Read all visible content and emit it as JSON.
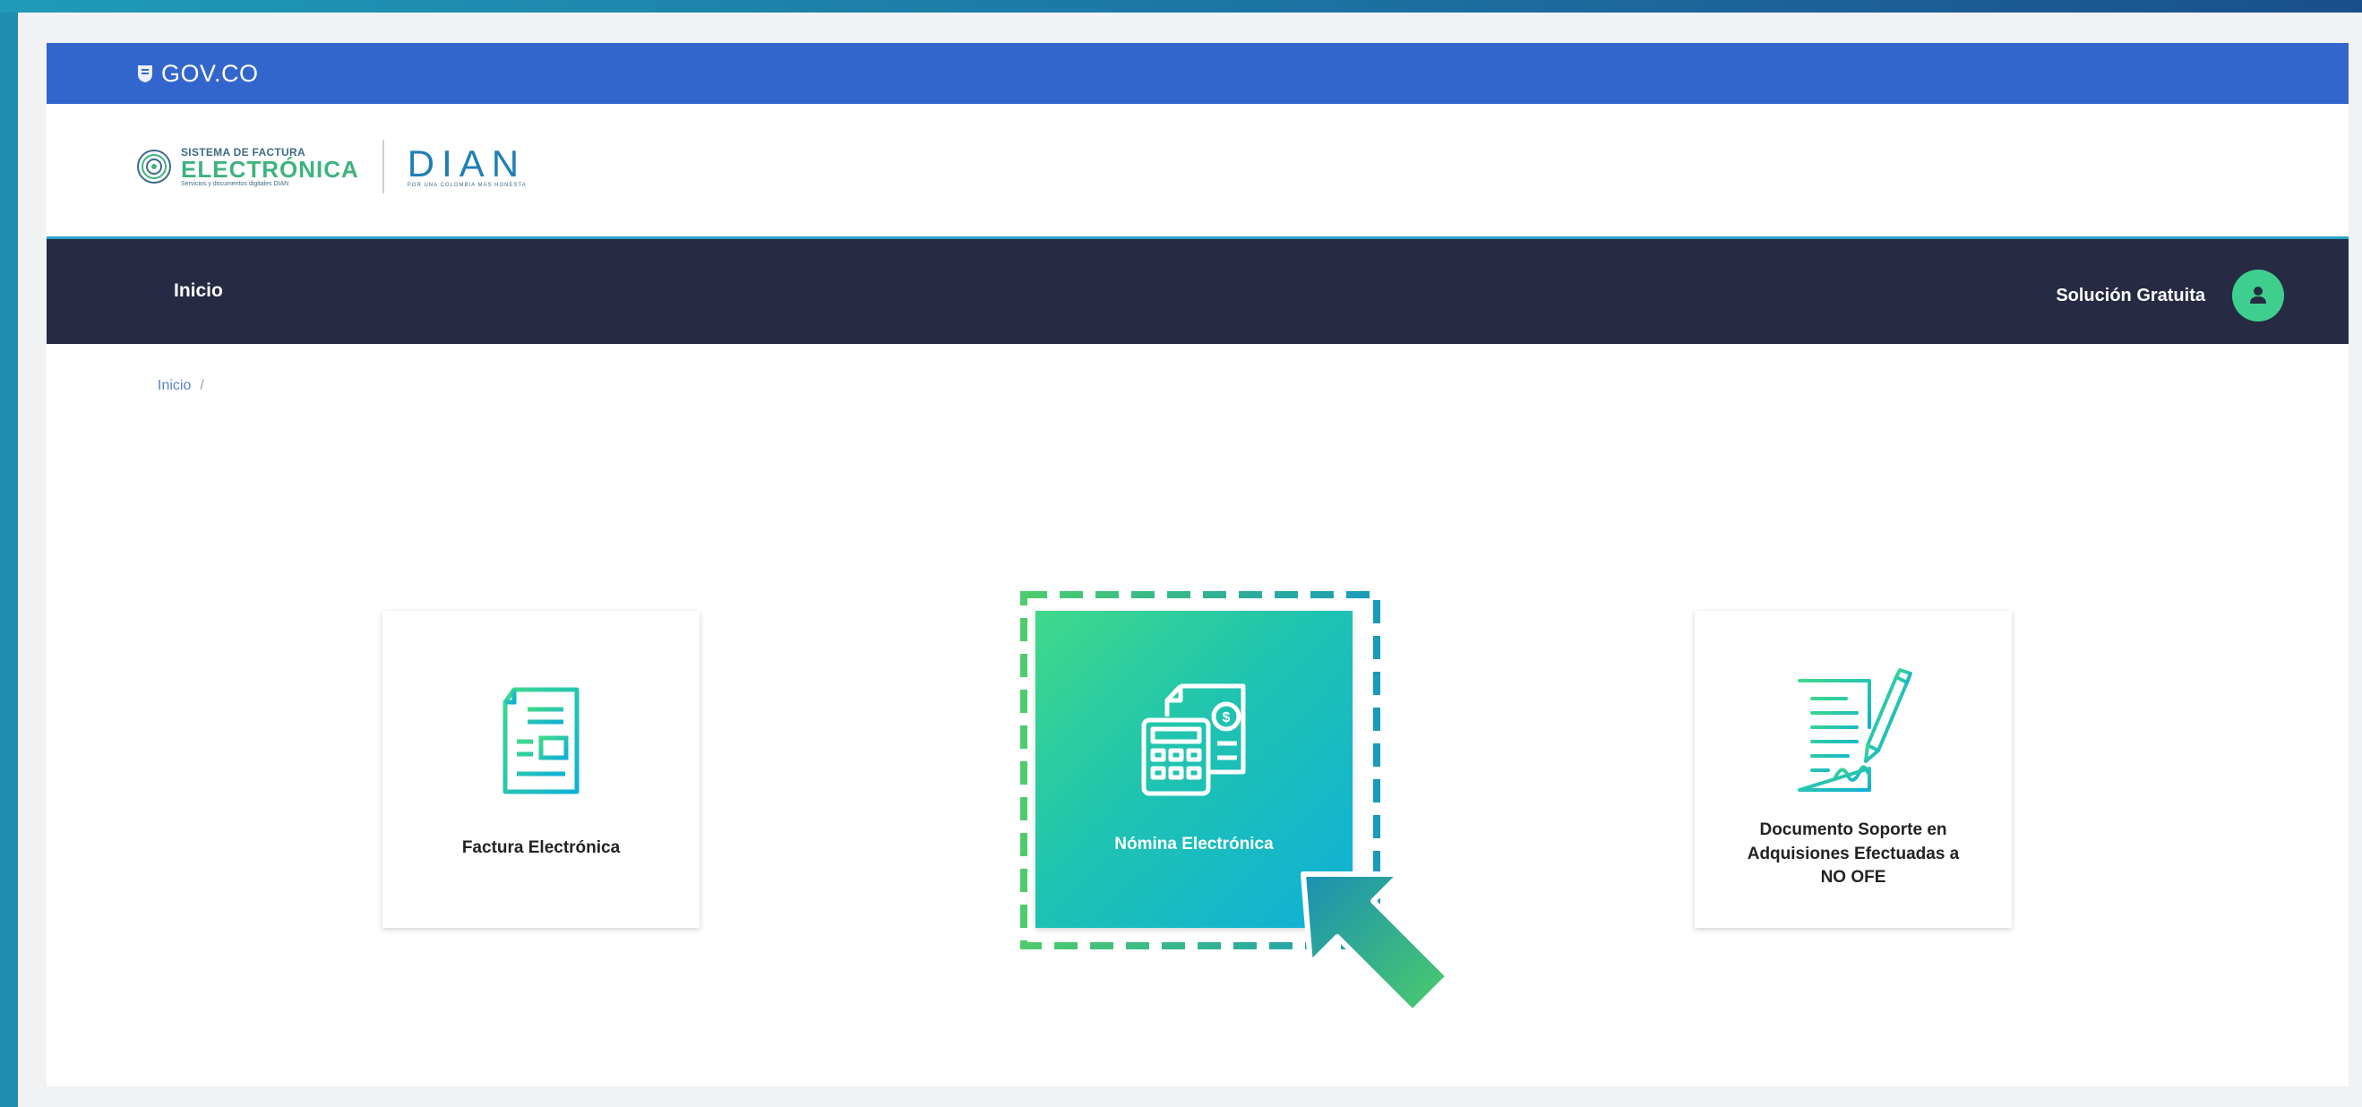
{
  "gov_bar": {
    "logo_text": "GOV.CO"
  },
  "brand": {
    "sfe_line1": "SISTEMA DE FACTURA",
    "sfe_line2": "ELECTRÓNICA",
    "sfe_tagline": "Servicios y documentos digitales DIAN",
    "dian_word": "DIAN",
    "dian_tagline": "POR UNA COLOMBIA MÁS HONESTA"
  },
  "nav": {
    "home_label": "Inicio",
    "right_label": "Solución Gratuita"
  },
  "breadcrumb": {
    "item": "Inicio",
    "separator": "/"
  },
  "cards": [
    {
      "label": "Factura Electrónica",
      "icon": "invoice-document-icon"
    },
    {
      "label": "Nómina Electrónica",
      "icon": "payroll-calculator-icon",
      "highlighted": true
    },
    {
      "label_line1": "Documento Soporte en",
      "label_line2": "Adquisiones Efectuadas a",
      "label_line3": "NO OFE",
      "icon": "signed-document-icon"
    }
  ],
  "colors": {
    "gov_blue": "#3366cc",
    "nav_dark": "#262a42",
    "accent_green": "#3ecf8e",
    "accent_teal": "#0fb0d8"
  }
}
